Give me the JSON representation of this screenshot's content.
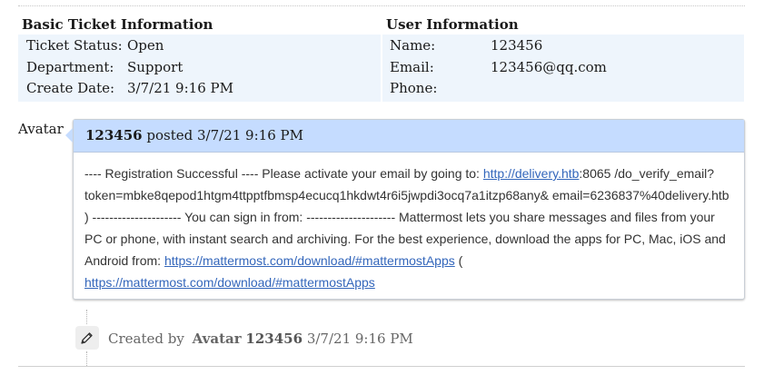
{
  "ticket_info": {
    "title": "Basic Ticket Information",
    "rows": [
      {
        "label": "Ticket Status:",
        "value": "Open"
      },
      {
        "label": "Department:",
        "value": "Support"
      },
      {
        "label": "Create Date:",
        "value": "3/7/21 9:16 PM"
      }
    ]
  },
  "user_info": {
    "title": "User Information",
    "rows": [
      {
        "label": "Name:",
        "value": "123456"
      },
      {
        "label": "Email:",
        "value": "123456@qq.com"
      },
      {
        "label": "Phone:",
        "value": ""
      }
    ]
  },
  "thread": {
    "avatar_label": "Avatar",
    "poster": "123456",
    "posted_text": "posted 3/7/21 9:16 PM",
    "body": {
      "text_1": "---- Registration Successful ---- Please activate your email by going to: ",
      "link_1": "http://delivery.htb",
      "text_2": ":8065 /do_verify_email?token=mbke8qepod1htgm4ttpptfbmsp4ecucq1hkdwt4r6i5jwpdi3ocq7a1itzp68any& email=6236837%40delivery.htb ) --------------------- You can sign in from: --------------------- Mattermost lets you share messages and files from your PC or phone, with instant search and archiving. For the best experience, download the apps for PC, Mac, iOS and Android from: ",
      "link_2": "https://mattermost.com/download/#mattermostApps",
      "text_3": " ( ",
      "link_3": "https://mattermost.com/download/#mattermostApps"
    }
  },
  "event": {
    "icon": "pencil-icon",
    "created_by": "Created by",
    "avatar_label": "Avatar",
    "user": "123456",
    "date": "3/7/21 9:16 PM"
  }
}
